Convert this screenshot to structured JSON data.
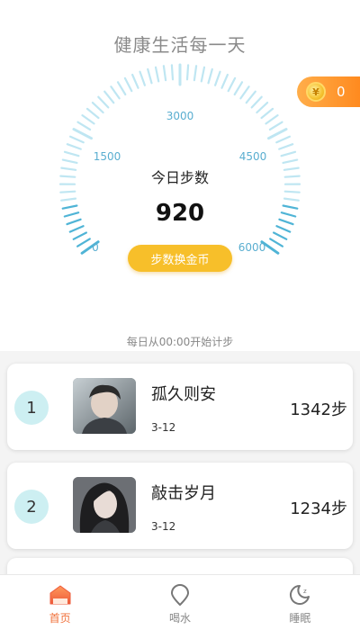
{
  "header": {
    "title": "健康生活每一天"
  },
  "coins": {
    "symbol": "¥",
    "count": "0"
  },
  "gauge": {
    "label": "今日步数",
    "value": "920",
    "ticks": [
      "0",
      "1500",
      "3000",
      "4500",
      "6000"
    ]
  },
  "exchange_button": {
    "label": "步数换金币"
  },
  "reset_note": "每日从00:00开始计步",
  "ranking": [
    {
      "rank": "1",
      "name": "孤久则安",
      "date": "3-12",
      "steps": "1342步"
    },
    {
      "rank": "2",
      "name": "敲击岁月",
      "date": "3-12",
      "steps": "1234步"
    }
  ],
  "tabs": [
    {
      "label": "首页",
      "icon": "home-icon",
      "active": true
    },
    {
      "label": "喝水",
      "icon": "water-drop-icon",
      "active": false
    },
    {
      "label": "睡眠",
      "icon": "moon-sleep-icon",
      "active": false
    }
  ],
  "colors": {
    "accent": "#f0703a",
    "gauge_light": "#bfe6f2",
    "gauge_dark": "#4fb4d6",
    "button": "#f7bf2a",
    "rank_badge": "#cdeff2"
  }
}
